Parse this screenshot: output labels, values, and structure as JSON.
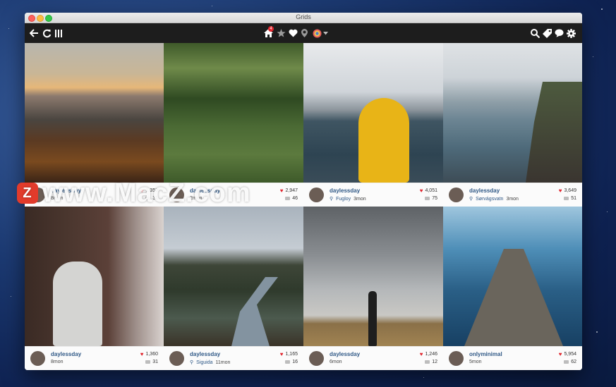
{
  "window": {
    "title": "Grids"
  },
  "toolbar": {
    "notification_count": "4"
  },
  "posts": [
    {
      "username": "daylessday",
      "sub_left": "",
      "age": "8mon",
      "likes": "1,350",
      "comments": "31",
      "location": ""
    },
    {
      "username": "daylessday",
      "location": "",
      "age": "2mon",
      "likes": "2,947",
      "comments": "46"
    },
    {
      "username": "daylessday",
      "location": "Fugloy",
      "age": "3mon",
      "likes": "4,051",
      "comments": "75"
    },
    {
      "username": "daylessday",
      "location": "Sørvágsvatn",
      "age": "3mon",
      "likes": "3,649",
      "comments": "51"
    },
    {
      "username": "daylessday",
      "location": "",
      "age": "8mon",
      "likes": "1,360",
      "comments": "31"
    },
    {
      "username": "daylessday",
      "location": "Siguida",
      "age": "11mon",
      "likes": "1,165",
      "comments": "16"
    },
    {
      "username": "daylessday",
      "location": "",
      "age": "6mon",
      "likes": "1,246",
      "comments": "12"
    },
    {
      "username": "onlyminimal",
      "location": "",
      "age": "5mon",
      "likes": "5,954",
      "comments": "62"
    }
  ],
  "watermark": {
    "logo": "Z",
    "text": "www.MacZ.com"
  }
}
